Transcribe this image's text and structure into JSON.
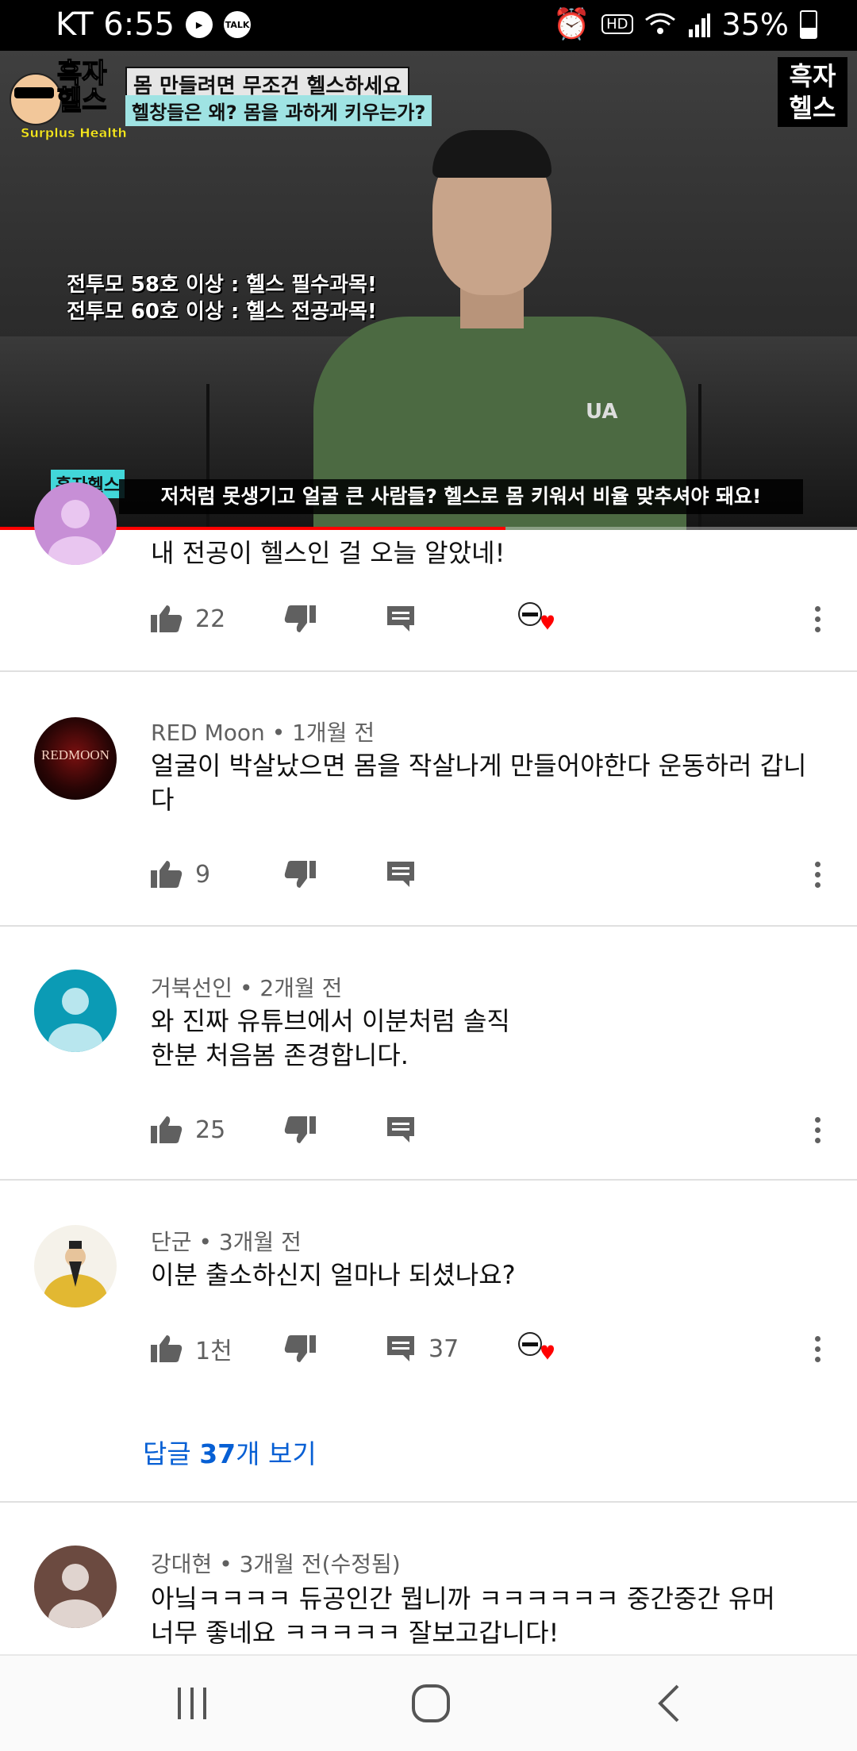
{
  "status_bar": {
    "carrier_time": "KT 6:55",
    "talk_label": "TALK",
    "hd_label": "HD",
    "battery": "35%",
    "battery_level": 0.35
  },
  "video": {
    "channel_logo_text": "흑자헬스",
    "channel_logo_sub": "Surplus Health",
    "title_line1": "몸 만들려면 무조건 헬스하세요",
    "title_line2": "헬창들은 왜? 몸을 과하게 키우는가?",
    "corner_logo": "흑자\n헬스",
    "overlay_line1": "전투모 58호 이상 : 헬스 필수과목!",
    "overlay_line2": "전투모 60호 이상 : 헬스 전공과목!",
    "tag": "흑자헬스",
    "subtitle": "저처럼 못생기고 얼굴 큰 사람들? 헬스로 몸 키워서 비율 맞추셔야 돼요!",
    "shirt_logo": "UA",
    "progress": 0.59
  },
  "comments": [
    {
      "author": "",
      "time": "",
      "text": "내 전공이 헬스인 걸 오늘 알았네!",
      "likes": "22",
      "replies": "",
      "creator_heart": true,
      "avatar_color": "#c78fd6"
    },
    {
      "author": "RED Moon",
      "time": "1개월 전",
      "text": "얼굴이 박살났으면 몸을 작살나게 만들어야한다 운동하러 갑니다",
      "likes": "9",
      "replies": "",
      "creator_heart": false,
      "avatar_text": "REDMOON"
    },
    {
      "author": "거북선인",
      "time": "2개월 전",
      "text": "와 진짜 유튜브에서 이분처럼 솔직한분 처음봄 존경합니다.",
      "likes": "25",
      "replies": "",
      "creator_heart": false,
      "avatar_color": "#0b9bb5"
    },
    {
      "author": "단군",
      "time": "3개월 전",
      "text": "이분 출소하신지 얼마나 되셨나요?",
      "likes": "1천",
      "replies": "37",
      "creator_heart": true,
      "view_replies_prefix": "답글 ",
      "view_replies_count": "37",
      "view_replies_suffix": "개 보기"
    },
    {
      "author": "강대현",
      "time": "3개월 전(수정됨)",
      "text": "아닠ㅋㅋㅋㅋ 듀공인간 뭡니까 ㅋㅋㅋㅋㅋㅋ 중간중간 유머 너무 좋네요 ㅋㅋㅋㅋㅋ 잘보고갑니다!",
      "avatar_color": "#6b4a40"
    }
  ],
  "nav": {
    "recents": "recents-icon",
    "home": "home-icon",
    "back": "back-icon"
  }
}
